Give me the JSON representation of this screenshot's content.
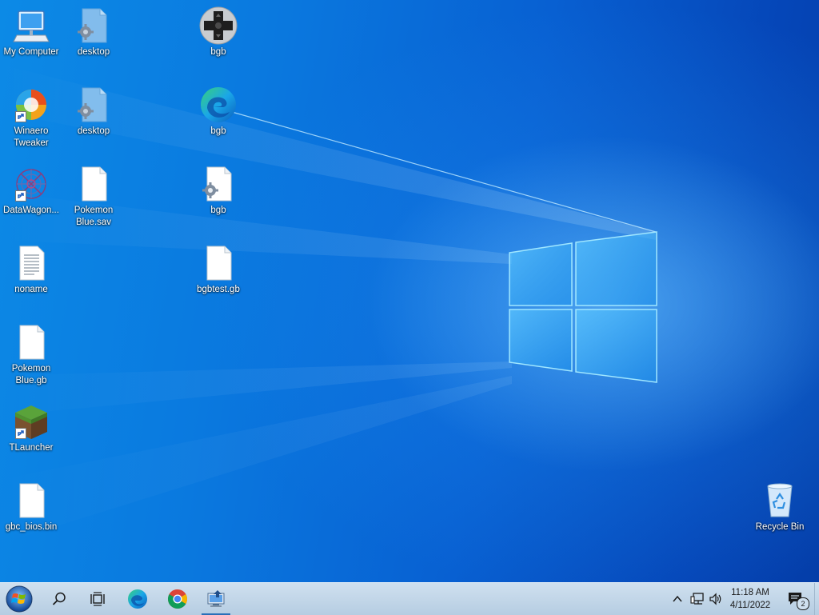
{
  "desktop": {
    "icons": [
      {
        "label": "My Computer",
        "icon": "computer-icon"
      },
      {
        "label": "desktop",
        "icon": "settings-file-icon"
      },
      {
        "label": "bgb",
        "icon": "gamepad-dpad-icon"
      },
      {
        "label": "Winaero Tweaker",
        "icon": "winaero-tweaker-icon",
        "shortcut": true
      },
      {
        "label": "desktop",
        "icon": "settings-file-icon"
      },
      {
        "label": "bgb",
        "icon": "edge-icon"
      },
      {
        "label": "DataWagon...",
        "icon": "datawagon-icon",
        "shortcut": true
      },
      {
        "label": "Pokemon Blue.sav",
        "icon": "blank-file-icon"
      },
      {
        "label": "bgb",
        "icon": "settings-file-icon"
      },
      {
        "label": "noname",
        "icon": "text-file-icon"
      },
      {
        "label": "bgbtest.gb",
        "icon": "blank-file-icon"
      },
      {
        "label": "Pokemon Blue.gb",
        "icon": "blank-file-icon"
      },
      {
        "label": "TLauncher",
        "icon": "minecraft-grass-block-icon",
        "shortcut": true
      },
      {
        "label": "gbc_bios.bin",
        "icon": "blank-file-icon"
      },
      {
        "label": "Recycle Bin",
        "icon": "recycle-bin-icon"
      }
    ]
  },
  "taskbar": {
    "start": {
      "icon": "windows-start-orb-icon"
    },
    "search": {
      "icon": "search-icon"
    },
    "task_view": {
      "icon": "task-view-icon"
    },
    "pinned": [
      {
        "name": "Microsoft Edge",
        "icon": "edge-icon"
      },
      {
        "name": "Google Chrome",
        "icon": "chrome-icon"
      },
      {
        "name": "Network app",
        "icon": "network-app-icon",
        "active": true
      }
    ],
    "tray": {
      "chevron": "chevron-up-icon",
      "network": "network-icon",
      "volume": "volume-icon"
    },
    "clock": {
      "time": "11:18 AM",
      "date": "4/11/2022"
    },
    "notifications": {
      "count": "2",
      "icon": "action-center-icon"
    }
  },
  "colors": {
    "taskbar_bg": "#c3d6e8",
    "desktop_bg": "#0a6fd8",
    "logo_glow": "#7fd8ff"
  }
}
